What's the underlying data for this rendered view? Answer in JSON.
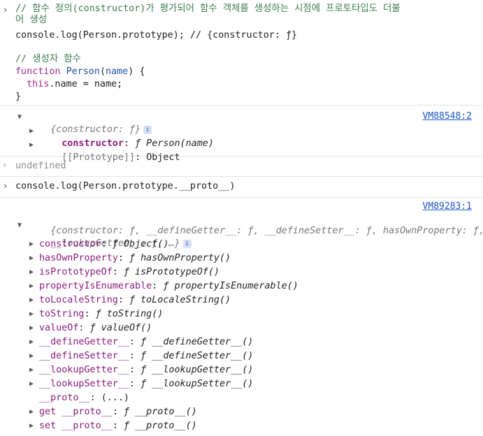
{
  "input1": {
    "lines": [
      "// 함수 정의(constructor)가 평가되어 함수 객체를 생성하는 시점에 프로토타입도 더불",
      "어 생성",
      "console.log(Person.prototype); // {constructor: ƒ}",
      "",
      "// 생성자 함수",
      "function Person(name) {",
      "  this.name = name;",
      "}"
    ]
  },
  "output1": {
    "source": "VM88548:2",
    "summary": "{constructor: ƒ}",
    "children": [
      {
        "key": "constructor",
        "sep": ": ",
        "value": "ƒ Person(name)"
      },
      {
        "key": "[[Prototype]]",
        "sep": ": ",
        "value": "Object"
      }
    ]
  },
  "undefined_text": "undefined",
  "input2": "console.log(Person.prototype.__proto__)",
  "output2": {
    "source": "VM89283:1",
    "summary_line1": "{constructor: ƒ, __defineGetter__: ƒ, __defineSetter__: ƒ, hasOwnProperty: ƒ,",
    "summary_line2": "__lookupGetter__: ƒ, …}",
    "children": [
      {
        "key": "constructor",
        "sep": ": ",
        "value": "ƒ Object()"
      },
      {
        "key": "hasOwnProperty",
        "sep": ": ",
        "value": "ƒ hasOwnProperty()"
      },
      {
        "key": "isPrototypeOf",
        "sep": ": ",
        "value": "ƒ isPrototypeOf()"
      },
      {
        "key": "propertyIsEnumerable",
        "sep": ": ",
        "value": "ƒ propertyIsEnumerable()"
      },
      {
        "key": "toLocaleString",
        "sep": ": ",
        "value": "ƒ toLocaleString()"
      },
      {
        "key": "toString",
        "sep": ": ",
        "value": "ƒ toString()"
      },
      {
        "key": "valueOf",
        "sep": ": ",
        "value": "ƒ valueOf()"
      },
      {
        "key": "__defineGetter__",
        "sep": ": ",
        "value": "ƒ __defineGetter__()"
      },
      {
        "key": "__defineSetter__",
        "sep": ": ",
        "value": "ƒ __defineSetter__()"
      },
      {
        "key": "__lookupGetter__",
        "sep": ": ",
        "value": "ƒ __lookupGetter__()"
      },
      {
        "key": "__lookupSetter__",
        "sep": ": ",
        "value": "ƒ __lookupSetter__()"
      },
      {
        "key": "__proto__",
        "sep": ": ",
        "value": "(...)"
      },
      {
        "key": "get __proto__",
        "sep": ": ",
        "value": "ƒ __proto__()"
      },
      {
        "key": "set __proto__",
        "sep": ": ",
        "value": "ƒ __proto__()"
      }
    ]
  },
  "icons": {
    "info": "info-icon",
    "expand": "triangle-right-icon",
    "collapse": "triangle-down-icon",
    "prompt": "chevron-right-icon",
    "return": "return-arrow-icon"
  },
  "colors": {
    "link": "#1a55c8",
    "key": "#8c1a7d",
    "comment": "#3b7a50",
    "keyword": "#a52a90"
  }
}
